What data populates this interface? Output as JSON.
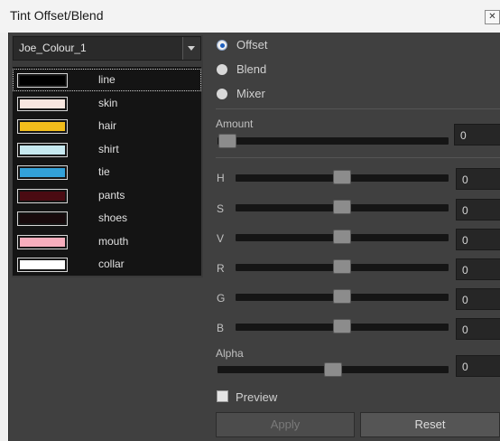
{
  "window": {
    "title": "Tint Offset/Blend"
  },
  "palette": {
    "selected": "Joe_Colour_1",
    "colors": [
      {
        "name": "line",
        "hex": "#000000"
      },
      {
        "name": "skin",
        "hex": "#f7e6df"
      },
      {
        "name": "hair",
        "hex": "#f2bd1c"
      },
      {
        "name": "shirt",
        "hex": "#c7e9f0"
      },
      {
        "name": "tie",
        "hex": "#33a1d9"
      },
      {
        "name": "pants",
        "hex": "#4a0b12"
      },
      {
        "name": "shoes",
        "hex": "#180a0c"
      },
      {
        "name": "mouth",
        "hex": "#f7aebd"
      },
      {
        "name": "collar",
        "hex": "#ffffff"
      }
    ]
  },
  "mode": {
    "options": [
      "Offset",
      "Blend",
      "Mixer"
    ],
    "selected": "Offset"
  },
  "amount": {
    "label": "Amount",
    "value": "0"
  },
  "channels": [
    {
      "label": "H",
      "value": "0",
      "level": 0.5
    },
    {
      "label": "S",
      "value": "0",
      "level": 0.5
    },
    {
      "label": "V",
      "value": "0",
      "level": 0.5
    },
    {
      "label": "R",
      "value": "0",
      "level": 0.5
    },
    {
      "label": "G",
      "value": "0",
      "level": 0.5
    },
    {
      "label": "B",
      "value": "0",
      "level": 0.5
    }
  ],
  "alpha": {
    "label": "Alpha",
    "value": "0",
    "level": 0.5
  },
  "preview": {
    "label": "Preview",
    "checked": false
  },
  "buttons": {
    "apply": "Apply",
    "reset": "Reset"
  }
}
